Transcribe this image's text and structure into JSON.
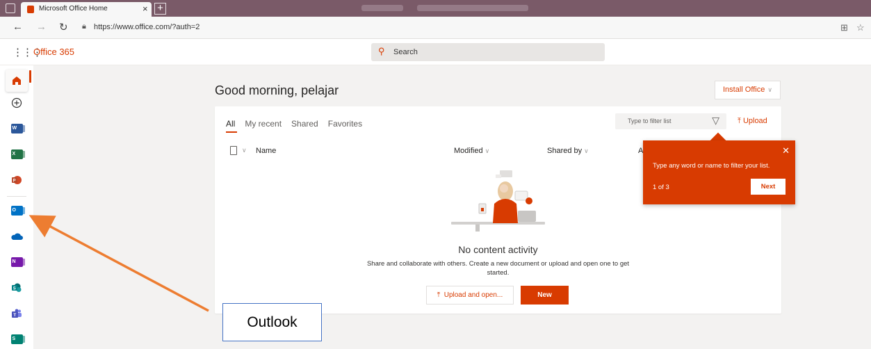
{
  "browser": {
    "tab_title": "Microsoft Office Home",
    "tab_close": "×",
    "new_tab": "+",
    "url": "https://www.office.com/?auth=2",
    "icons": [
      "back-icon",
      "forward-icon",
      "refresh-icon",
      "lock-icon",
      "collections-icon",
      "favorites-icon"
    ]
  },
  "header": {
    "waffle": "⋮⋮⋮",
    "brand": "Office 365",
    "search_label": "Search"
  },
  "rail": {
    "items": [
      {
        "name": "home",
        "active": true
      },
      {
        "name": "create"
      },
      {
        "name": "word",
        "letter": "W",
        "color": "#2b579a"
      },
      {
        "name": "excel",
        "letter": "X",
        "color": "#217346"
      },
      {
        "name": "powerpoint",
        "letter": "P",
        "color": "#d24726"
      },
      {
        "name": "outlook",
        "letter": "O",
        "color": "#0072c6"
      },
      {
        "name": "onedrive",
        "color": "#0364b8"
      },
      {
        "name": "onenote",
        "letter": "N",
        "color": "#7719aa"
      },
      {
        "name": "sharepoint",
        "letter": "S",
        "color": "#038387"
      },
      {
        "name": "teams",
        "color": "#4b53bc"
      },
      {
        "name": "sway",
        "letter": "S",
        "color": "#008272"
      }
    ]
  },
  "main": {
    "greeting": "Good morning, pelajar",
    "install_label": "Install Office",
    "tabs": [
      "All",
      "My recent",
      "Shared",
      "Favorites"
    ],
    "filter_placeholder": "Type to filter list",
    "upload_label": "Upload",
    "columns": {
      "name": "Name",
      "modified": "Modified",
      "shared_by": "Shared by",
      "activity": "A"
    },
    "empty_title": "No content activity",
    "empty_desc": "Share and collaborate with others. Create a new document or upload and open one to get started.",
    "upload_open_label": "Upload and open...",
    "new_label": "New"
  },
  "callout": {
    "message": "Type any word or name to filter your list.",
    "step": "1 of 3",
    "next_label": "Next"
  },
  "annotation": {
    "label": "Outlook"
  },
  "colors": {
    "accent": "#d83b01",
    "annotation_arrow": "#ed7d31",
    "annotation_box_border": "#4472c4"
  }
}
